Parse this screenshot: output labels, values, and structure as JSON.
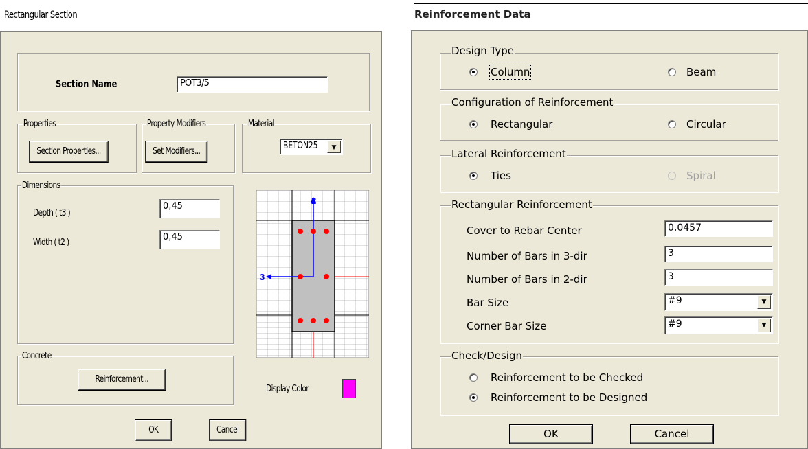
{
  "left": {
    "window_title": "Rectangular Section",
    "section_name_label": "Section Name",
    "section_name_value": "POT3/5",
    "properties": {
      "title": "Properties",
      "button": "Section Properties..."
    },
    "property_modifiers": {
      "title": "Property Modifiers",
      "button": "Set Modifiers..."
    },
    "material": {
      "title": "Material",
      "selected": "BETON25"
    },
    "dimensions": {
      "title": "Dimensions",
      "depth_label": "Depth  ( t3 )",
      "depth_value": "0,45",
      "width_label": "Width  ( t2 )",
      "width_value": "0,45"
    },
    "preview_axes": {
      "vertical": "2",
      "horizontal": "3"
    },
    "concrete": {
      "title": "Concrete",
      "button": "Reinforcement..."
    },
    "display_color_label": "Display Color",
    "display_color": "#ff00ff",
    "ok": "OK",
    "cancel": "Cancel"
  },
  "right": {
    "window_title": "Reinforcement Data",
    "design_type": {
      "title": "Design Type",
      "column": "Column",
      "beam": "Beam",
      "selected": "column"
    },
    "configuration": {
      "title": "Configuration of Reinforcement",
      "rectangular": "Rectangular",
      "circular": "Circular",
      "selected": "rectangular"
    },
    "lateral": {
      "title": "Lateral Reinforcement",
      "ties": "Ties",
      "spiral": "Spiral",
      "selected": "ties"
    },
    "rect_reinf": {
      "title": "Rectangular Reinforcement",
      "cover_label": "Cover to Rebar Center",
      "cover_value": "0,0457",
      "bars3_label": "Number of Bars in 3-dir",
      "bars3_value": "3",
      "bars2_label": "Number of Bars in 2-dir",
      "bars2_value": "3",
      "barsize_label": "Bar Size",
      "barsize_value": "#9",
      "corner_label": "Corner Bar Size",
      "corner_value": "#9"
    },
    "check_design": {
      "title": "Check/Design",
      "checked": "Reinforcement to be Checked",
      "designed": "Reinforcement to be Designed",
      "selected": "designed"
    },
    "ok": "OK",
    "cancel": "Cancel"
  },
  "colors": {
    "dialog_bg": "#ece9d8",
    "rebar": "#ff0000",
    "axis": "#0000ff"
  }
}
